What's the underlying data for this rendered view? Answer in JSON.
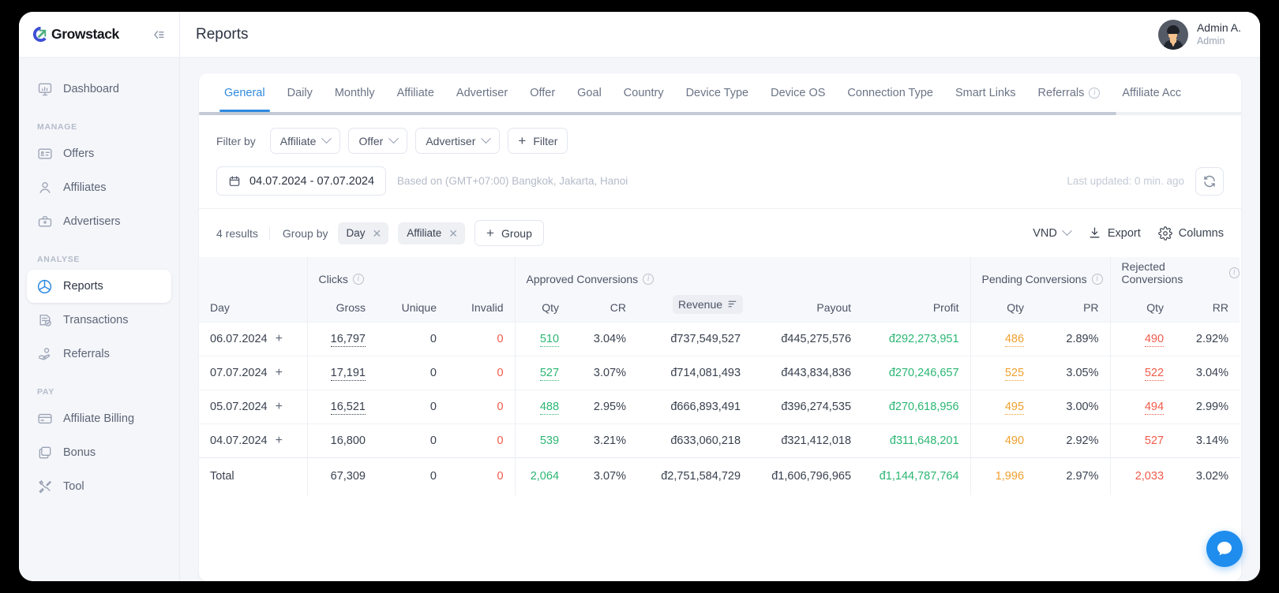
{
  "brand": {
    "name": "Growstack",
    "collapse_icon": "collapse-sidebar-icon"
  },
  "sidebar": {
    "top_items": [
      {
        "label": "Dashboard",
        "icon": "dashboard-icon"
      }
    ],
    "sections": [
      {
        "label": "MANAGE",
        "items": [
          {
            "label": "Offers",
            "icon": "offers-card-icon"
          },
          {
            "label": "Affiliates",
            "icon": "user-icon"
          },
          {
            "label": "Advertisers",
            "icon": "briefcase-icon"
          }
        ]
      },
      {
        "label": "ANALYSE",
        "items": [
          {
            "label": "Reports",
            "icon": "pie-chart-icon",
            "active": true
          },
          {
            "label": "Transactions",
            "icon": "transactions-icon"
          },
          {
            "label": "Referrals",
            "icon": "referrals-hand-icon"
          }
        ]
      },
      {
        "label": "PAY",
        "items": [
          {
            "label": "Affiliate Billing",
            "icon": "credit-card-icon"
          },
          {
            "label": "Bonus",
            "icon": "bonus-layers-icon"
          },
          {
            "label": "Tool",
            "icon": "tools-icon"
          }
        ]
      }
    ]
  },
  "topbar": {
    "title": "Reports",
    "user": {
      "name": "Admin A.",
      "role": "Admin",
      "avatar": "user-avatar"
    }
  },
  "tabs": [
    {
      "label": "General",
      "active": true
    },
    {
      "label": "Daily"
    },
    {
      "label": "Monthly"
    },
    {
      "label": "Affiliate"
    },
    {
      "label": "Advertiser"
    },
    {
      "label": "Offer"
    },
    {
      "label": "Goal"
    },
    {
      "label": "Country"
    },
    {
      "label": "Device Type"
    },
    {
      "label": "Device OS"
    },
    {
      "label": "Connection Type"
    },
    {
      "label": "Smart Links"
    },
    {
      "label": "Referrals",
      "info": true
    },
    {
      "label": "Affiliate Acc"
    }
  ],
  "filters": {
    "label": "Filter by",
    "dropdowns": [
      "Affiliate",
      "Offer",
      "Advertiser"
    ],
    "add_filter_label": "Filter"
  },
  "date_row": {
    "range": "04.07.2024 - 07.07.2024",
    "timezone_note": "Based on (GMT+07:00) Bangkok, Jakarta, Hanoi",
    "last_updated": "Last updated: 0 min. ago",
    "refresh_icon": "refresh-icon",
    "calendar_icon": "calendar-icon"
  },
  "toolbar": {
    "results": "4 results",
    "group_by_label": "Group by",
    "group_chips": [
      "Day",
      "Affiliate"
    ],
    "add_group_label": "Group",
    "currency": "VND",
    "export_label": "Export",
    "columns_label": "Columns"
  },
  "chat": {
    "icon": "chat-bubble-icon"
  },
  "chart_data": {
    "type": "table",
    "title": "General report grouped by Day and Affiliate",
    "currency_symbol": "đ",
    "group_headers": [
      {
        "label": "",
        "span": 1
      },
      {
        "label": "Clicks",
        "span": 3,
        "info": true
      },
      {
        "label": "Approved Conversions",
        "span": 5,
        "info": true
      },
      {
        "label": "Pending Conversions",
        "span": 2,
        "info": true
      },
      {
        "label": "Rejected Conversions",
        "span": 2,
        "info": true
      }
    ],
    "columns": [
      "Day",
      "Gross",
      "Unique",
      "Invalid",
      "Qty",
      "CR",
      "Revenue",
      "Payout",
      "Profit",
      "Qty",
      "PR",
      "Qty",
      "RR"
    ],
    "sorted_column": "Revenue",
    "rows": [
      {
        "day": "06.07.2024",
        "gross": "16,797",
        "unique": "0",
        "invalid": "0",
        "ac_qty": "510",
        "cr": "3.04%",
        "revenue": "đ737,549,527",
        "payout": "đ445,275,576",
        "profit": "đ292,273,951",
        "pend_qty": "486",
        "pr": "2.89%",
        "rej_qty": "490",
        "rr": "2.92%"
      },
      {
        "day": "07.07.2024",
        "gross": "17,191",
        "unique": "0",
        "invalid": "0",
        "ac_qty": "527",
        "cr": "3.07%",
        "revenue": "đ714,081,493",
        "payout": "đ443,834,836",
        "profit": "đ270,246,657",
        "pend_qty": "525",
        "pr": "3.05%",
        "rej_qty": "522",
        "rr": "3.04%"
      },
      {
        "day": "05.07.2024",
        "gross": "16,521",
        "unique": "0",
        "invalid": "0",
        "ac_qty": "488",
        "cr": "2.95%",
        "revenue": "đ666,893,491",
        "payout": "đ396,274,535",
        "profit": "đ270,618,956",
        "pend_qty": "495",
        "pr": "3.00%",
        "rej_qty": "494",
        "rr": "2.99%"
      },
      {
        "day": "04.07.2024",
        "gross": "16,800",
        "unique": "0",
        "invalid": "0",
        "ac_qty": "539",
        "cr": "3.21%",
        "revenue": "đ633,060,218",
        "payout": "đ321,412,018",
        "profit": "đ311,648,201",
        "pend_qty": "490",
        "pr": "2.92%",
        "rej_qty": "527",
        "rr": "3.14%"
      }
    ],
    "total": {
      "day": "Total",
      "gross": "67,309",
      "unique": "0",
      "invalid": "0",
      "ac_qty": "2,064",
      "cr": "3.07%",
      "revenue": "đ2,751,584,729",
      "payout": "đ1,606,796,965",
      "profit": "đ1,144,787,764",
      "pend_qty": "1,996",
      "pr": "2.97%",
      "rej_qty": "2,033",
      "rr": "3.02%"
    },
    "colors": {
      "positive": "#2bb673",
      "negative": "#f15b4a",
      "pending": "#f0a02e",
      "accent": "#2f8ae0"
    }
  }
}
